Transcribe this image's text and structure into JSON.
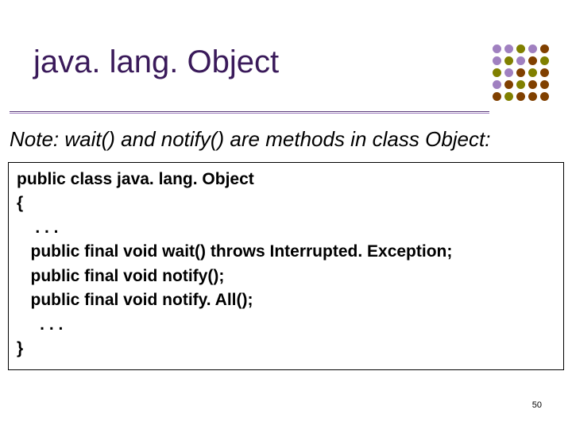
{
  "title": "java. lang. Object",
  "note": "Note: wait() and notify() are methods in class Object:",
  "code": {
    "l1": "public class java. lang. Object",
    "l2": "{",
    "l3": "    . . .",
    "l4": "   public final void wait() throws Interrupted. Exception;",
    "l5": "   public final void notify();",
    "l6": "   public final void notify. All();",
    "l7": "     . . .",
    "l8": "}"
  },
  "page_number": "50",
  "dot_colors": [
    "#a080c0",
    "#a080c0",
    "#808000",
    "#a080c0",
    "#804000",
    "#a080c0",
    "#808000",
    "#a080c0",
    "#804000",
    "#808000",
    "#808000",
    "#a080c0",
    "#804000",
    "#808000",
    "#804000",
    "#a080c0",
    "#804000",
    "#808000",
    "#804000",
    "#804000",
    "#804000",
    "#808000",
    "#804000",
    "#804000",
    "#804000"
  ]
}
